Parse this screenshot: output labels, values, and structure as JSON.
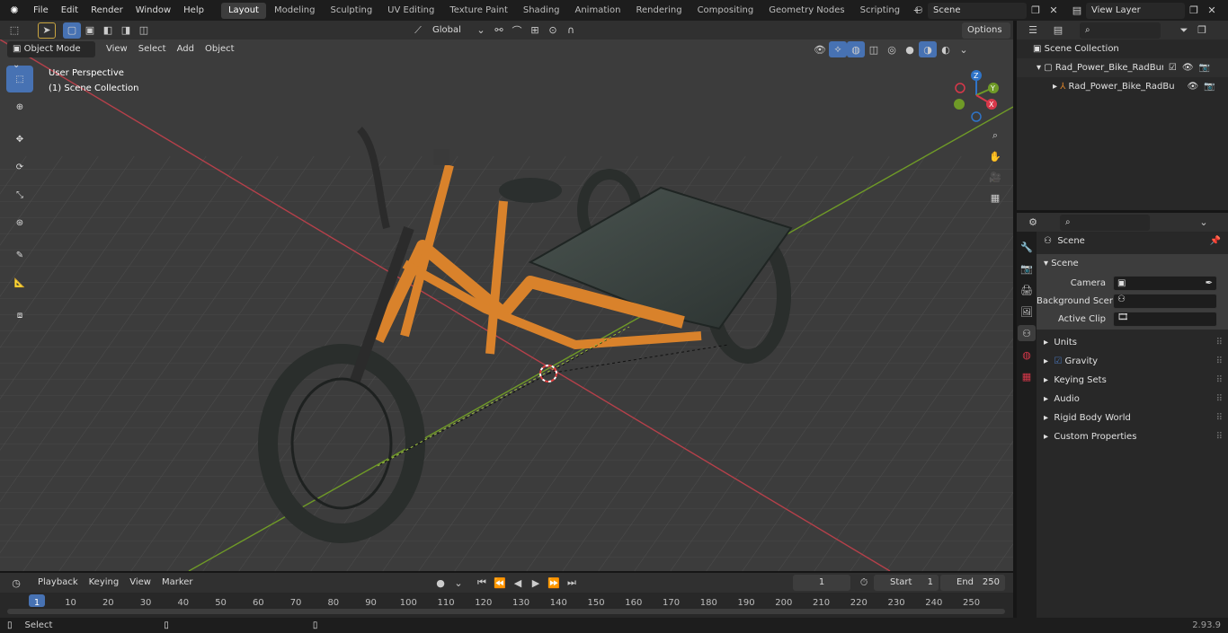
{
  "menu": [
    "File",
    "Edit",
    "Render",
    "Window",
    "Help"
  ],
  "workspaces": [
    "Layout",
    "Modeling",
    "Sculpting",
    "UV Editing",
    "Texture Paint",
    "Shading",
    "Animation",
    "Rendering",
    "Compositing",
    "Geometry Nodes",
    "Scripting"
  ],
  "scene_name": "Scene",
  "view_layer": "View Layer",
  "header": {
    "transform": "Global",
    "options": "Options"
  },
  "viewport": {
    "mode": "Object Mode",
    "menus": [
      "View",
      "Select",
      "Add",
      "Object"
    ],
    "overlay_title": "User Perspective",
    "overlay_sub": "(1) Scene Collection",
    "gizmo": {
      "x": "X",
      "y": "Y",
      "z": "Z"
    }
  },
  "outliner": {
    "root": "Scene Collection",
    "items": [
      "Rad_Power_Bike_RadBurro_v",
      "Rad_Power_Bike_RadBu"
    ]
  },
  "properties": {
    "context": "Scene",
    "section": "Scene",
    "camera_label": "Camera",
    "bg_label": "Background Scene",
    "clip_label": "Active Clip",
    "panels": [
      "Units",
      "Gravity",
      "Keying Sets",
      "Audio",
      "Rigid Body World",
      "Custom Properties"
    ]
  },
  "timeline": {
    "menus": [
      "Playback",
      "Keying",
      "View",
      "Marker"
    ],
    "current_frame": "1",
    "start_label": "Start",
    "start": "1",
    "end_label": "End",
    "end": "250",
    "ticks": [
      "1",
      "10",
      "20",
      "30",
      "40",
      "50",
      "60",
      "70",
      "80",
      "90",
      "100",
      "110",
      "120",
      "130",
      "140",
      "150",
      "160",
      "170",
      "180",
      "190",
      "200",
      "210",
      "220",
      "230",
      "240",
      "250"
    ]
  },
  "status": {
    "left": "Select",
    "version": "2.93.9"
  },
  "colors": {
    "accent": "#4772b3",
    "bike_frame": "#d9822b",
    "x_axis": "#b5404a",
    "y_axis": "#6f9a27"
  }
}
